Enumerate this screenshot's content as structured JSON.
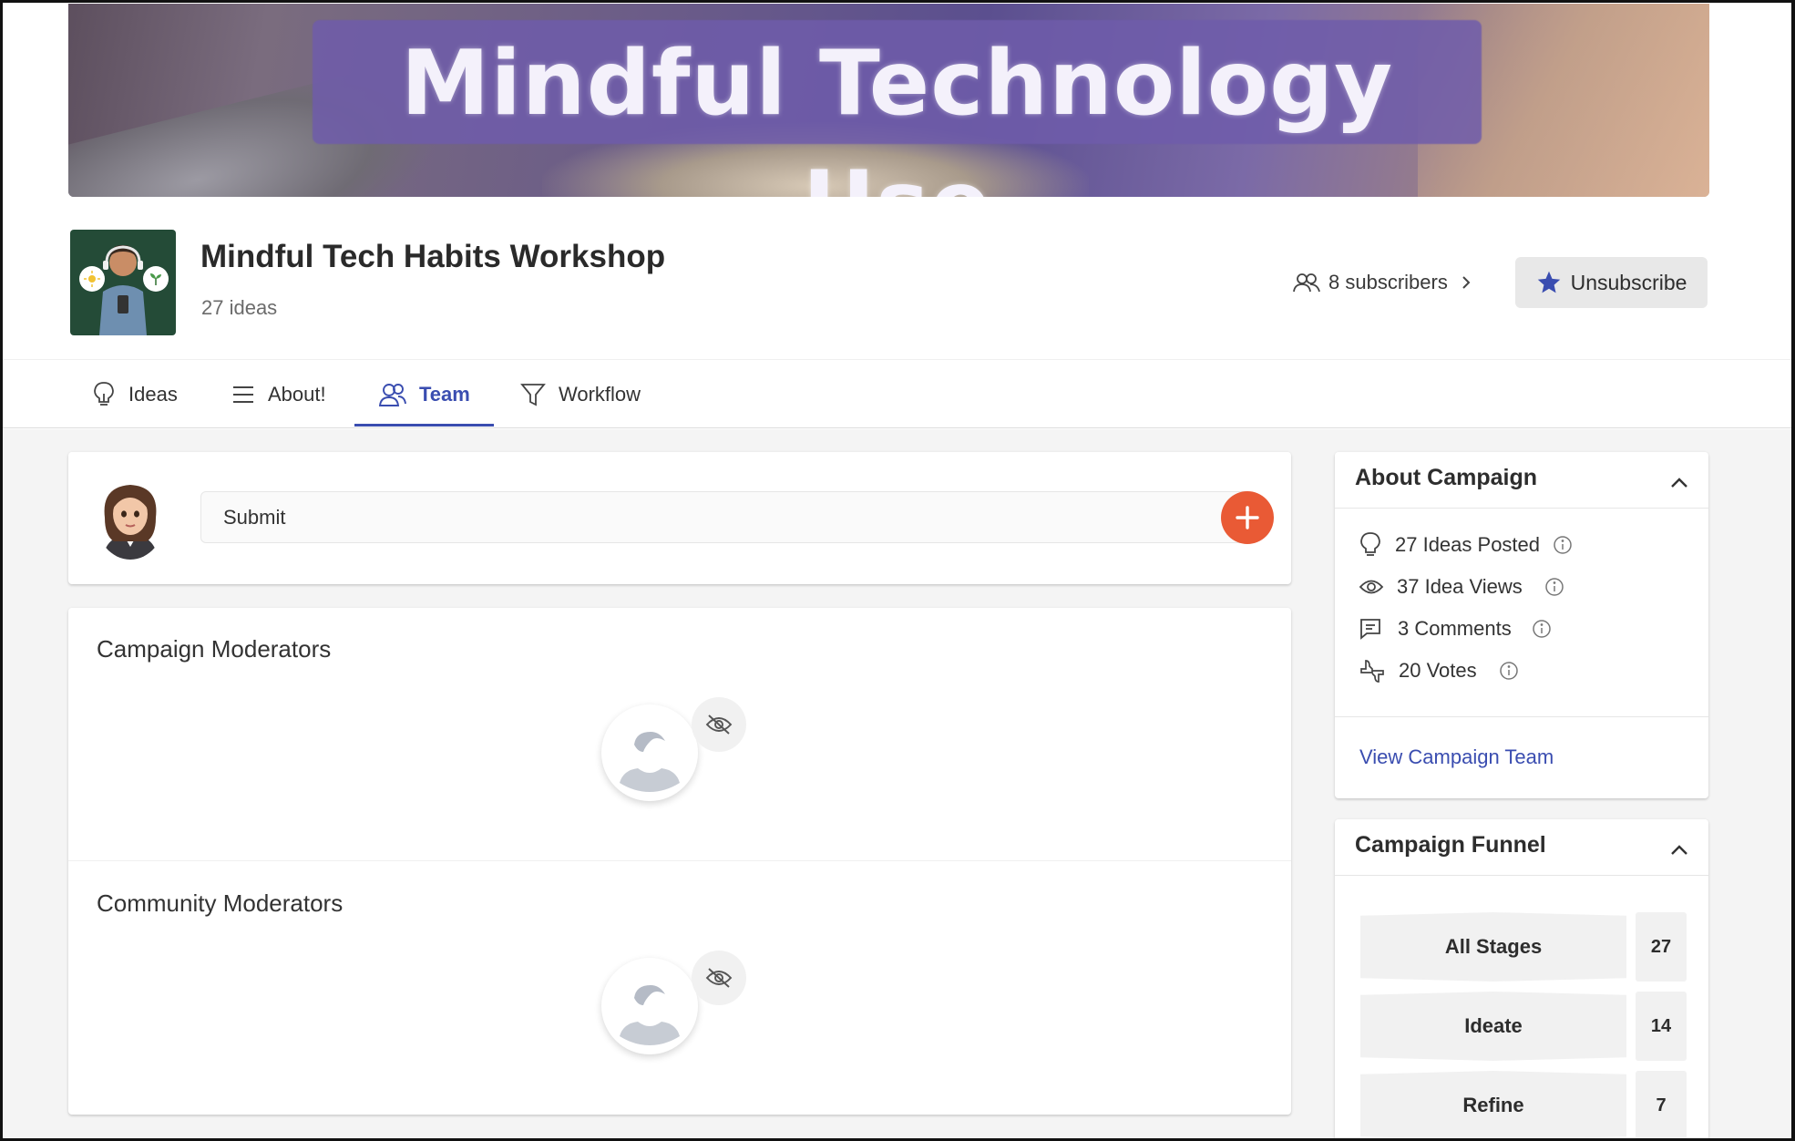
{
  "banner": {
    "title": "Mindful Technology Use"
  },
  "campaign": {
    "title": "Mindful Tech Habits Workshop",
    "idea_count": "27 ideas",
    "subscribers": "8 subscribers",
    "unsubscribe_label": "Unsubscribe"
  },
  "tabs": [
    {
      "label": "Ideas",
      "icon": "lightbulb-icon"
    },
    {
      "label": "About!",
      "icon": "list-icon"
    },
    {
      "label": "Team",
      "icon": "users-icon",
      "active": true
    },
    {
      "label": "Workflow",
      "icon": "funnel-icon"
    }
  ],
  "submit": {
    "placeholder": "Submit"
  },
  "team": {
    "campaign_moderators": "Campaign Moderators",
    "community_moderators": "Community Moderators"
  },
  "about": {
    "title": "About Campaign",
    "stats": [
      {
        "label": "27 Ideas Posted",
        "icon": "lightbulb-icon"
      },
      {
        "label": "37 Idea Views",
        "icon": "eye-icon"
      },
      {
        "label": "3 Comments",
        "icon": "comment-icon"
      },
      {
        "label": "20 Votes",
        "icon": "thumbs-icon"
      }
    ],
    "view_team_link": "View Campaign Team"
  },
  "funnel": {
    "title": "Campaign Funnel",
    "stages": [
      {
        "label": "All Stages",
        "count": "27"
      },
      {
        "label": "Ideate",
        "count": "14"
      },
      {
        "label": "Refine",
        "count": "7"
      }
    ]
  },
  "colors": {
    "accent": "#3a4db0",
    "add_button": "#e95a35",
    "star": "#3a4db0"
  }
}
